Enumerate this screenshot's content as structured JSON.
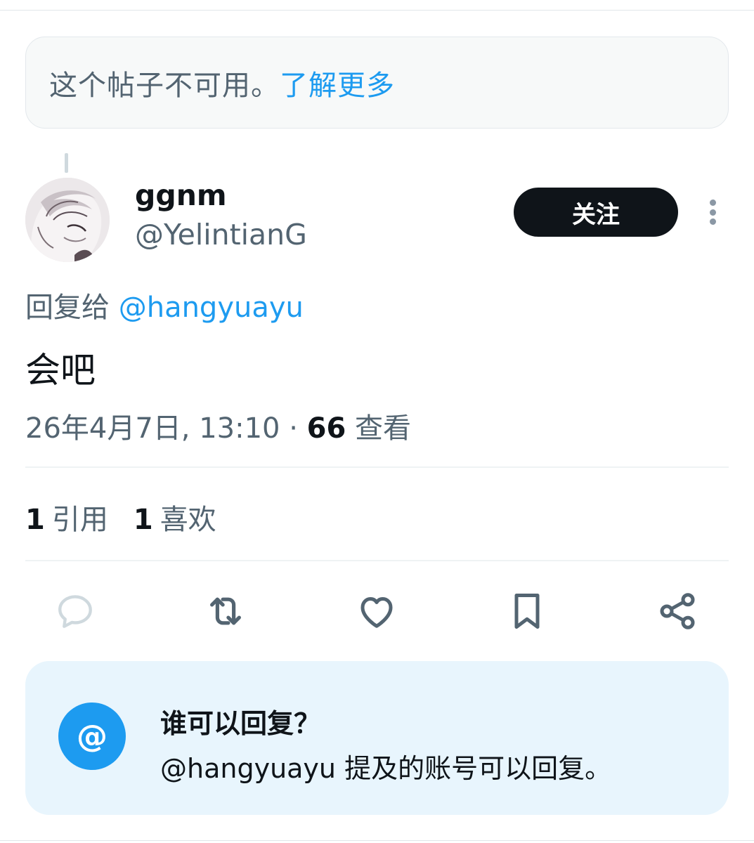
{
  "unavailable_notice": {
    "text": "这个帖子不可用。",
    "link": "了解更多"
  },
  "author": {
    "name": "ggnm",
    "handle": "@YelintianG",
    "follow_label": "关注"
  },
  "tweet": {
    "reply_prefix": "回复给 ",
    "reply_mention": "@hangyuayu",
    "text": "会吧",
    "timestamp": "26年4月7日, 13:10 · ",
    "views_count": "66",
    "views_label": " 查看"
  },
  "stats": {
    "quotes_count": "1",
    "quotes_label": "引用",
    "likes_count": "1",
    "likes_label": "喜欢"
  },
  "actions": [
    "reply-icon",
    "retweet-icon",
    "like-icon",
    "bookmark-icon",
    "share-icon"
  ],
  "reply_restriction": {
    "title": "谁可以回复？",
    "description": "@hangyuayu 提及的账号可以回复。",
    "icon": "@"
  },
  "colors": {
    "accent": "#1d9bf0",
    "text_primary": "#0f1419",
    "text_secondary": "#536471",
    "card_bg": "#e8f5fd"
  }
}
